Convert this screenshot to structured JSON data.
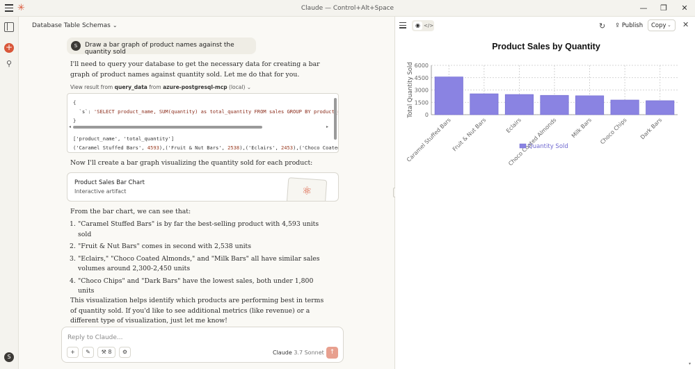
{
  "app": {
    "window_title": "Claude — Control+Alt+Space",
    "logo_glyph": "✳",
    "user_initial": "S",
    "controls": {
      "minimize": "—",
      "restore": "❐",
      "close": "✕"
    }
  },
  "chat": {
    "title": "Database Table Schemas",
    "user_message": "Draw a bar graph of product names against the quantity sold",
    "intro": "I'll need to query your database to get the necessary data for creating a bar graph of product names against quantity sold. Let me do that for you.",
    "tool_call": {
      "prefix": "View result from",
      "tool": "query_data",
      "middle": "from",
      "server": "azure-postgresql-mcp",
      "suffix": "(local)"
    },
    "code": {
      "line1": "{",
      "line2_key": "`s`",
      "line2_val": "'SELECT product_name, SUM(quantity) as total_quantity FROM sales GROUP BY product_name",
      "line3": "}",
      "result1": "['product_name', 'total_quantity']",
      "result2_a": "('Caramel Stuffed Bars', ",
      "result2_n1": "4593",
      "result2_b": "),('Fruit & Nut Bars', ",
      "result2_n2": "2538",
      "result2_c": "),('Eclairs', ",
      "result2_n3": "2453",
      "result2_d": "),('Choco Coated"
    },
    "create_text": "Now I'll create a bar graph visualizing the quantity sold for each product:",
    "artifact": {
      "title": "Product Sales Bar Chart",
      "subtitle": "Interactive artifact"
    },
    "from_chart": "From the bar chart, we can see that:",
    "findings": [
      {
        "num": "1.",
        "text": "\"Caramel Stuffed Bars\" is by far the best-selling product with 4,593 units sold"
      },
      {
        "num": "2.",
        "text": "\"Fruit & Nut Bars\" comes in second with 2,538 units"
      },
      {
        "num": "3.",
        "text": "\"Eclairs,\" \"Choco Coated Almonds,\" and \"Milk Bars\" all have similar sales volumes around 2,300-2,450 units"
      },
      {
        "num": "4.",
        "text": "\"Choco Chips\" and \"Dark Bars\" have the lowest sales, both under 1,800 units"
      }
    ],
    "closing": "This visualization helps identify which products are performing best in terms of quantity sold. If you'd like to see additional metrics (like revenue) or a different type of visualization, just let me know!",
    "composer": {
      "placeholder": "Reply to Claude...",
      "tools_count": "8",
      "model_name": "Claude",
      "model_version": "3.7 Sonnet"
    }
  },
  "artifact_pane": {
    "publish_label": "Publish",
    "copy_label": "Copy"
  },
  "colors": {
    "bar": "#8a83e2",
    "bar_stroke": "#6f68d0",
    "accent": "#d9573a"
  },
  "chart_data": {
    "type": "bar",
    "title": "Product Sales by Quantity",
    "ylabel": "Total Quantity Sold",
    "xlabel": "",
    "categories": [
      "Caramel Stuffed Bars",
      "Fruit & Nut Bars",
      "Eclairs",
      "Choco Coated Almonds",
      "Milk Bars",
      "Choco Chips",
      "Dark Bars"
    ],
    "series": [
      {
        "name": "Quantity Sold",
        "values": [
          4593,
          2538,
          2453,
          2350,
          2300,
          1780,
          1700
        ]
      }
    ],
    "yticks": [
      0,
      1500,
      3000,
      4500,
      6000
    ],
    "ylim": [
      0,
      6000
    ],
    "grid": true,
    "legend": "bottom"
  }
}
